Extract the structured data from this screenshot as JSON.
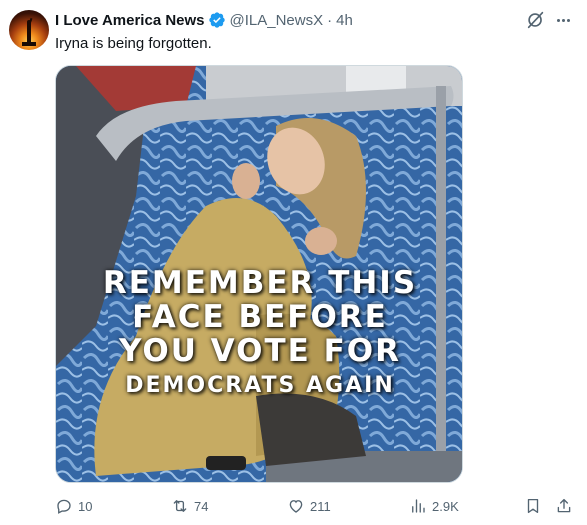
{
  "tweet": {
    "author_name": "I Love America News",
    "handle": "@ILA_NewsX",
    "separator": "·",
    "time": "4h",
    "text": "Iryna is being forgotten.",
    "verified_color": "#1d9bf0"
  },
  "media": {
    "overlay_lines": [
      "REMEMBER THIS",
      "FACE BEFORE",
      "YOU VOTE FOR",
      "DEMOCRATS AGAIN"
    ]
  },
  "actions": {
    "replies": "10",
    "reposts": "74",
    "likes": "211",
    "views": "2.9K"
  },
  "icons": [
    "grok-icon",
    "more-icon",
    "verified-badge-icon",
    "reply-icon",
    "retweet-icon",
    "like-icon",
    "views-icon",
    "bookmark-icon",
    "share-icon"
  ],
  "colors": {
    "text_primary": "#0f1419",
    "text_secondary": "#536471",
    "accent": "#1d9bf0"
  }
}
